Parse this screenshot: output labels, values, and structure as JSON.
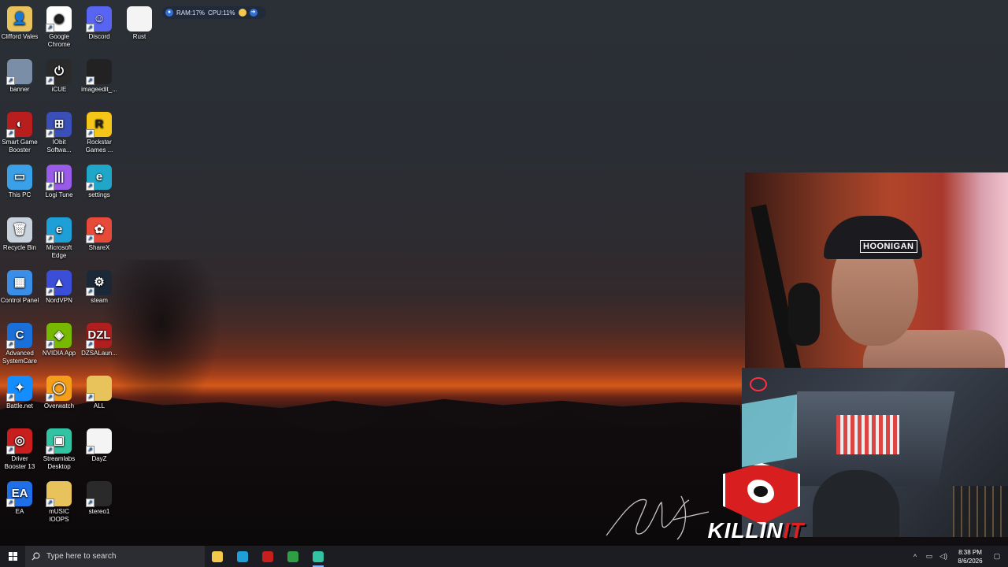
{
  "desktop": {
    "icons": [
      {
        "label": "Clifford Vales",
        "color": "#e8c25a",
        "glyph": "👤"
      },
      {
        "label": "Google Chrome",
        "color": "#ffffff",
        "glyph": "◉"
      },
      {
        "label": "Discord",
        "color": "#5865f2",
        "glyph": "☺"
      },
      {
        "label": "Rust",
        "color": "#f4f4f4",
        "glyph": ""
      },
      {
        "label": "banner",
        "color": "#7a8ea8",
        "glyph": ""
      },
      {
        "label": "iCUE",
        "color": "#2a2a2a",
        "glyph": "⏻"
      },
      {
        "label": "imageedit_...",
        "color": "#222222",
        "glyph": ""
      },
      {
        "label": "Smart Game Booster",
        "color": "#b81e1e",
        "glyph": "◐"
      },
      {
        "label": "IObit Softwa...",
        "color": "#3a4fb8",
        "glyph": "⊞"
      },
      {
        "label": "Rockstar Games ...",
        "color": "#f5c518",
        "glyph": "R"
      },
      {
        "label": "This PC",
        "color": "#3aa0e8",
        "glyph": "▭"
      },
      {
        "label": "Logi Tune",
        "color": "#9a5be8",
        "glyph": "|||"
      },
      {
        "label": "settings",
        "color": "#1fa6c8",
        "glyph": "e"
      },
      {
        "label": "Recycle Bin",
        "color": "#c8d2dc",
        "glyph": "🗑"
      },
      {
        "label": "Microsoft Edge",
        "color": "#1f9fd8",
        "glyph": "e"
      },
      {
        "label": "ShareX",
        "color": "#e84a3a",
        "glyph": "✿"
      },
      {
        "label": "Control Panel",
        "color": "#3a8ee8",
        "glyph": "▦"
      },
      {
        "label": "NordVPN",
        "color": "#3a4ed8",
        "glyph": "▲"
      },
      {
        "label": "steam",
        "color": "#1b2838",
        "glyph": "⚙"
      },
      {
        "label": "Advanced SystemCare",
        "color": "#1a6fd8",
        "glyph": "C"
      },
      {
        "label": "NVIDIA App",
        "color": "#76b900",
        "glyph": "◈"
      },
      {
        "label": "DZSALaun...",
        "color": "#b01e1e",
        "glyph": "DZL"
      },
      {
        "label": "Battle.net",
        "color": "#148eff",
        "glyph": "✦"
      },
      {
        "label": "Overwatch",
        "color": "#f59e1a",
        "glyph": "◯"
      },
      {
        "label": "ALL",
        "color": "#e8c25a",
        "glyph": ""
      },
      {
        "label": "Driver Booster 13",
        "color": "#c81e1e",
        "glyph": "◎"
      },
      {
        "label": "Streamlabs Desktop",
        "color": "#31c3a2",
        "glyph": "▣"
      },
      {
        "label": "DayZ",
        "color": "#f4f4f4",
        "glyph": ""
      },
      {
        "label": "EA",
        "color": "#1f6fe8",
        "glyph": "EA"
      },
      {
        "label": "mUSIC lOOPS",
        "color": "#e8c25a",
        "glyph": ""
      },
      {
        "label": "stereo1",
        "color": "#2a2a2a",
        "glyph": ""
      }
    ]
  },
  "sysmon": {
    "ram": "RAM:17%",
    "cpu": "CPU:11%"
  },
  "webcam": {
    "cap_text": "HOONIGAN"
  },
  "logo": {
    "text_main": "KILLIN",
    "text_accent": "IT"
  },
  "taskbar": {
    "search_placeholder": "Type here to search",
    "apps": [
      {
        "name": "file-explorer",
        "color": "#f2c94c",
        "active": false
      },
      {
        "name": "edge",
        "color": "#1f9fd8",
        "active": false
      },
      {
        "name": "smart-game-booster",
        "color": "#c81e1e",
        "active": false
      },
      {
        "name": "xbox",
        "color": "#2ea043",
        "active": false
      },
      {
        "name": "streamlabs",
        "color": "#31c3a2",
        "active": true
      }
    ],
    "time": "8:38 PM",
    "date": "8/6/2026"
  }
}
